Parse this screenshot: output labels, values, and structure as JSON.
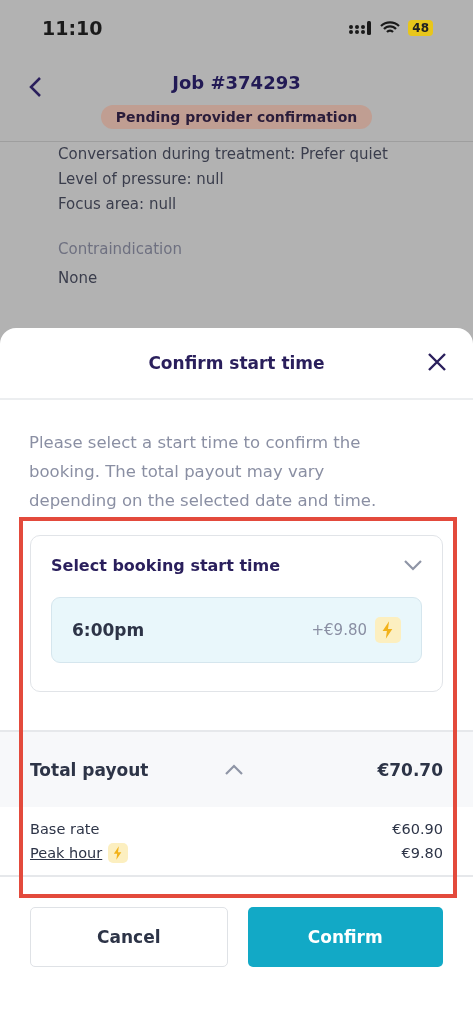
{
  "status_bar": {
    "time": "11:10",
    "battery": "48"
  },
  "header": {
    "title": "Job #374293",
    "status_badge": "Pending provider confirmation"
  },
  "details": [
    {
      "kind": "line",
      "text": "Conversation during treatment: Prefer quiet"
    },
    {
      "kind": "line",
      "text": "Level of pressure: null"
    },
    {
      "kind": "line",
      "text": "Focus area: null"
    },
    {
      "kind": "label",
      "text": "Contraindication"
    },
    {
      "kind": "line",
      "text": "None"
    }
  ],
  "sheet": {
    "title": "Confirm start time",
    "description": "Please select a start time to confirm the booking. The total payout may vary depending on the selected date and time.",
    "selector": {
      "label": "Select booking start time",
      "expanded": false,
      "options": [
        {
          "time": "6:00pm",
          "surcharge": "+€9.80",
          "peak": true,
          "selected": true
        }
      ]
    },
    "payout": {
      "label": "Total payout",
      "total": "€70.70",
      "expanded": true,
      "items": [
        {
          "label": "Base rate",
          "amount": "€60.90",
          "peak": false
        },
        {
          "label": "Peak hour",
          "amount": "€9.80",
          "peak": true
        }
      ]
    },
    "buttons": [
      {
        "kind": "secondary",
        "label": "Cancel"
      },
      {
        "kind": "primary",
        "label": "Confirm"
      }
    ]
  }
}
